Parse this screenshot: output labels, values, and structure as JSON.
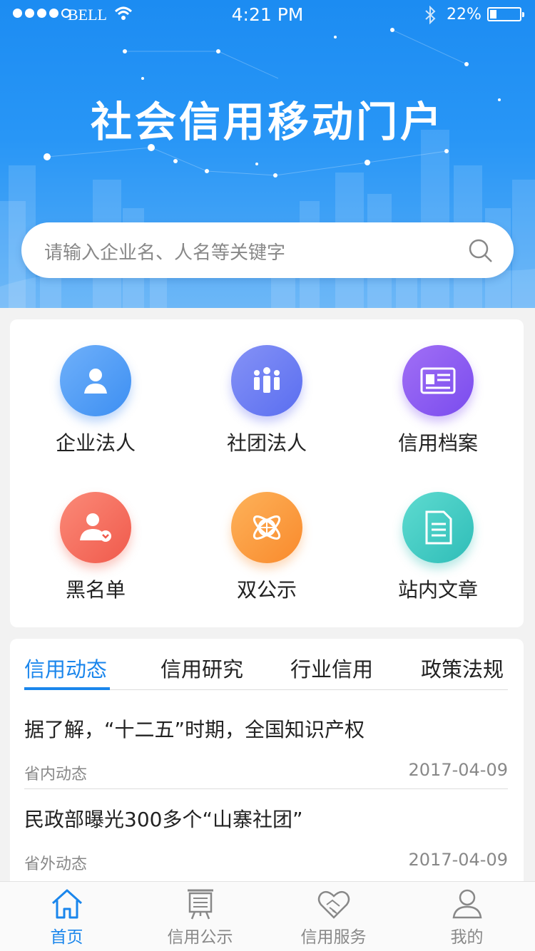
{
  "status_bar": {
    "carrier": "BELL",
    "time": "4:21 PM",
    "battery_percent": "22%",
    "battery_level": 0.22
  },
  "header": {
    "title": "社会信用移动门户"
  },
  "search": {
    "placeholder": "请输入企业名、人名等关键字",
    "icon": "search-icon"
  },
  "categories": [
    {
      "label": "企业法人",
      "icon": "person-icon",
      "color": "#4f9cf5"
    },
    {
      "label": "社团法人",
      "icon": "group-icon",
      "color": "#6a7ef2"
    },
    {
      "label": "信用档案",
      "icon": "id-card-icon",
      "color": "#8a5cf0"
    },
    {
      "label": "黑名单",
      "icon": "blacklist-user-icon",
      "color": "#f56a5c"
    },
    {
      "label": "双公示",
      "icon": "globe-icon",
      "color": "#fb9c3e"
    },
    {
      "label": "站内文章",
      "icon": "document-icon",
      "color": "#36c7c0"
    }
  ],
  "news": {
    "tabs": [
      "信用动态",
      "信用研究",
      "行业信用",
      "政策法规"
    ],
    "active_tab": 0,
    "items": [
      {
        "headline": "据了解，“十二五”时期，全国知识产权",
        "category": "省内动态",
        "date": "2017-04-09"
      },
      {
        "headline": "民政部曝光300多个“山寨社团”",
        "category": "省外动态",
        "date": "2017-04-09"
      }
    ]
  },
  "tabbar": {
    "items": [
      {
        "label": "首页",
        "icon": "home-icon"
      },
      {
        "label": "信用公示",
        "icon": "notice-board-icon"
      },
      {
        "label": "信用服务",
        "icon": "handshake-icon"
      },
      {
        "label": "我的",
        "icon": "profile-icon"
      }
    ],
    "active": 0
  },
  "colors": {
    "accent": "#1a86ec",
    "header_top": "#1c8cf2",
    "header_bottom": "#58adf6"
  }
}
